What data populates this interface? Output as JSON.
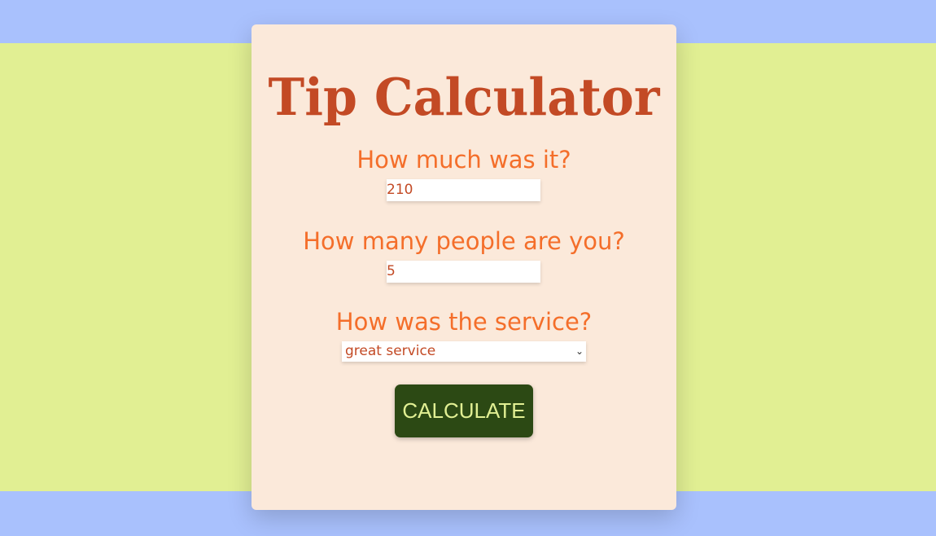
{
  "app": {
    "title": "Tip Calculator"
  },
  "form": {
    "bill": {
      "label": "How much was it?",
      "value": "210"
    },
    "people": {
      "label": "How many people are you?",
      "value": "5"
    },
    "service": {
      "label": "How was the service?",
      "selected": "great service",
      "chevron_icon": "chevron-down-icon"
    },
    "calculate_label": "CALCULATE"
  },
  "colors": {
    "page_background": "#a9c1fd",
    "band_background": "#e1ef93",
    "card_background": "#fbe9da",
    "title": "#c34a25",
    "label": "#f46e2a",
    "button_background": "#2c4914",
    "button_text": "#e1ef93"
  }
}
